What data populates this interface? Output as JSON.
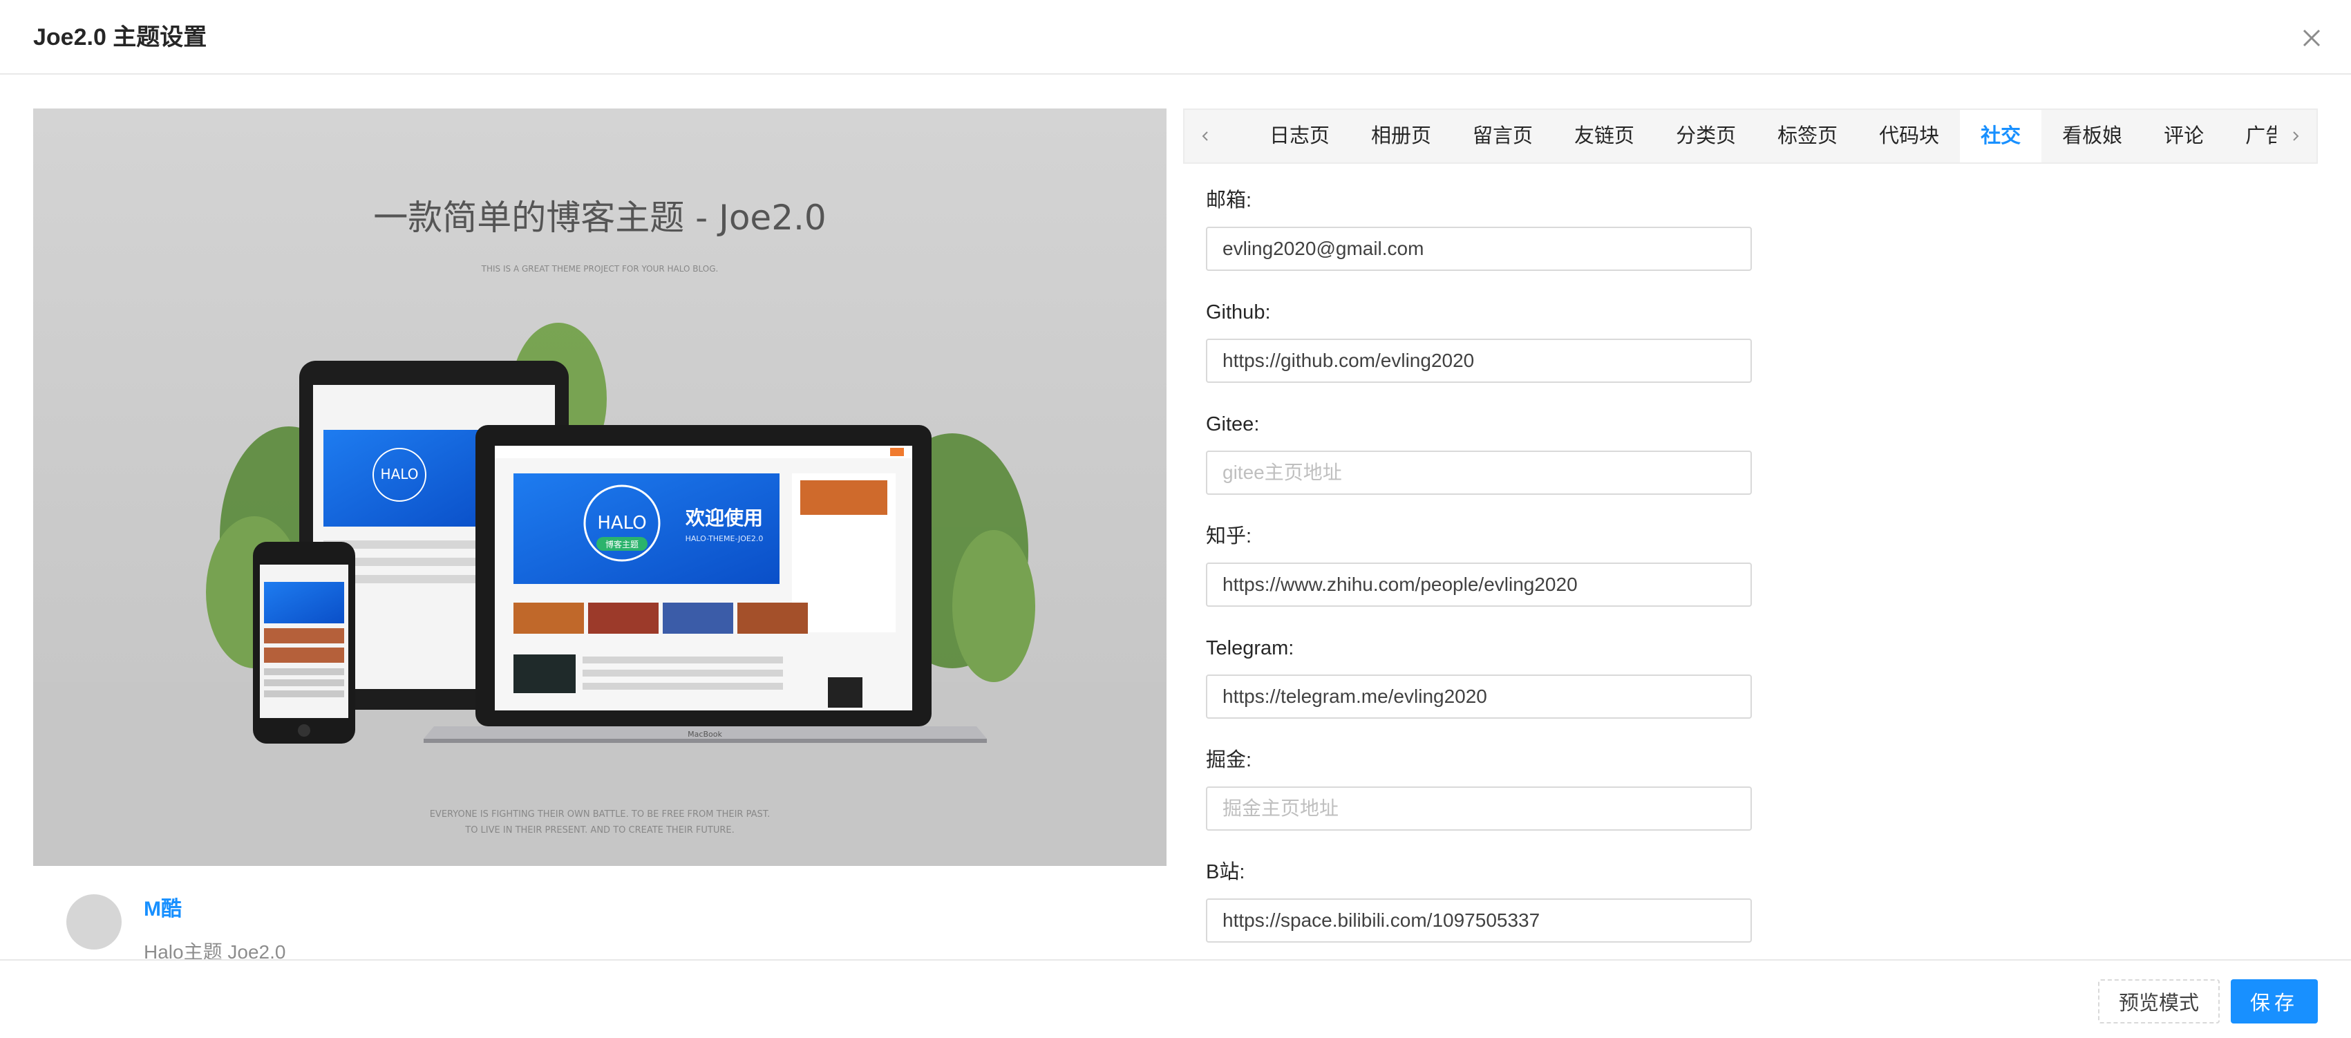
{
  "dialog": {
    "title": "Joe2.0 主题设置"
  },
  "preview": {
    "headline": "一款简单的博客主题 - Joe2.0",
    "subhead": "THIS IS A GREAT THEME PROJECT FOR YOUR HALO BLOG.",
    "welcome": "欢迎使用",
    "welcome_sub": "HALO-THEME-JOE2.0",
    "halo_logo": "HALO",
    "halo_badge": "博客主题",
    "device_brand": "MacBook",
    "quote_line1": "EVERYONE IS FIGHTING THEIR OWN BATTLE. TO BE FREE FROM THEIR PAST.",
    "quote_line2": "TO LIVE IN THEIR PRESENT. AND TO CREATE THEIR FUTURE."
  },
  "author": {
    "name": "M酷",
    "description": "Halo主题 Joe2.0"
  },
  "tabs": {
    "items": [
      "日志页",
      "相册页",
      "留言页",
      "友链页",
      "分类页",
      "标签页",
      "代码块",
      "社交",
      "看板娘",
      "评论",
      "广告"
    ],
    "active": "社交"
  },
  "form": {
    "email": {
      "label": "邮箱:",
      "value": "evling2020@gmail.com",
      "placeholder": ""
    },
    "github": {
      "label": "Github:",
      "value": "https://github.com/evling2020",
      "placeholder": ""
    },
    "gitee": {
      "label": "Gitee:",
      "value": "",
      "placeholder": "gitee主页地址"
    },
    "zhihu": {
      "label": "知乎:",
      "value": "https://www.zhihu.com/people/evling2020",
      "placeholder": ""
    },
    "telegram": {
      "label": "Telegram:",
      "value": "https://telegram.me/evling2020",
      "placeholder": ""
    },
    "juejin": {
      "label": "掘金:",
      "value": "",
      "placeholder": "掘金主页地址"
    },
    "bilibili": {
      "label": "B站:",
      "value": "https://space.bilibili.com/1097505337",
      "placeholder": ""
    }
  },
  "footer": {
    "preview_label": "预览模式",
    "save_label": "保存"
  },
  "colors": {
    "accent": "#1890ff",
    "border": "#d9d9d9",
    "tab_bg": "#f5f5f5"
  }
}
